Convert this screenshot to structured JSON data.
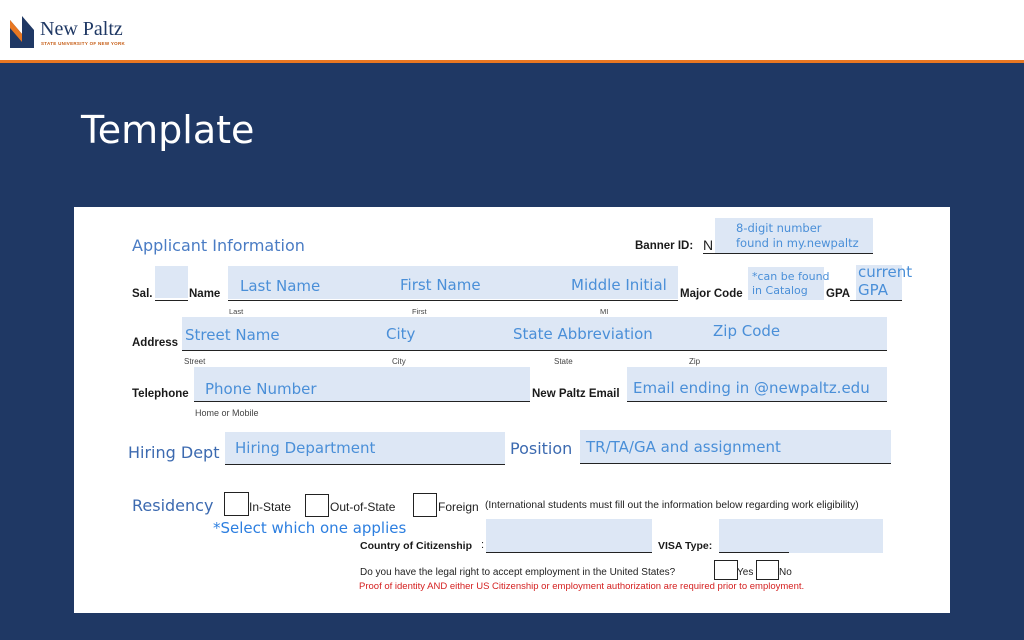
{
  "header": {
    "logo_name": "New Paltz",
    "logo_sub": "STATE UNIVERSITY OF NEW YORK"
  },
  "slide": {
    "title": "Template"
  },
  "form": {
    "section_title": "Applicant Information",
    "banner": {
      "label": "Banner ID:",
      "prefix": "N",
      "hint": "8-digit number\nfound in my.newpaltz"
    },
    "name_row": {
      "sal_label": "Sal.",
      "name_label": "Name",
      "hints": [
        "Last Name",
        "First Name",
        "Middle Initial"
      ],
      "sub_labels": [
        "Last",
        "First",
        "MI"
      ],
      "major_label": "Major Code",
      "major_hint": "*can be found\nin Catalog",
      "gpa_label": "GPA",
      "gpa_hint": "current\nGPA"
    },
    "address_row": {
      "label": "Address",
      "hints": [
        "Street Name",
        "City",
        "State Abbreviation",
        "Zip Code"
      ],
      "sub_labels": [
        "Street",
        "City",
        "State",
        "Zip"
      ]
    },
    "phone_row": {
      "label": "Telephone",
      "hint": "Phone Number",
      "sub_label": "Home or Mobile",
      "email_label": "New Paltz Email",
      "email_hint": "Email ending in @newpaltz.edu"
    },
    "dept_row": {
      "label": "Hiring Dept",
      "hint": "Hiring Department",
      "position_label": "Position",
      "position_hint": "TR/TA/GA and assignment"
    },
    "residency": {
      "label": "Residency",
      "options": [
        "In-State",
        "Out-of-State",
        "Foreign"
      ],
      "note": "(International students must fill out the information below regarding work eligibility)",
      "hint": "*Select which one applies"
    },
    "citizenship": {
      "label": "Country of Citizenship",
      "colon": ":",
      "visa_label": "VISA Type:"
    },
    "legal": {
      "question": "Do you have the legal right to accept employment in the United States?",
      "yes": "Yes",
      "no": "No",
      "warning": "Proof of identity AND either US Citizenship or employment authorization are required prior to employment."
    }
  }
}
